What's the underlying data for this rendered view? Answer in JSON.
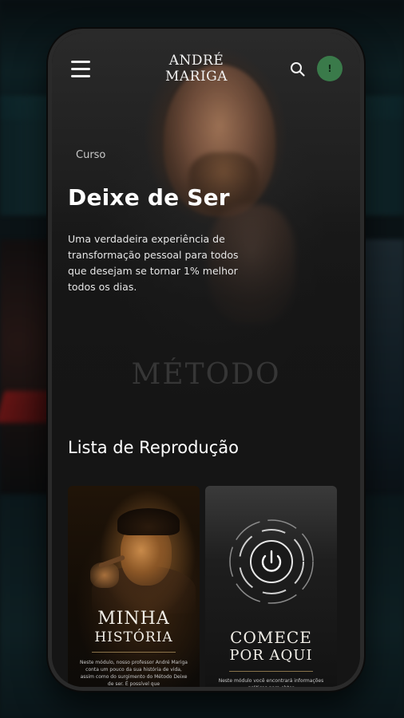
{
  "app": {
    "logo_line1": "ANDRÉ",
    "logo_line2": "MARIGA",
    "avatar_initial": "!"
  },
  "hero": {
    "tag": "Curso",
    "title": "Deixe de Ser",
    "description": "Uma verdadeira experiência de transformação pessoal para todos que desejam se tornar 1% melhor todos os dias.",
    "brand_word": "MÉTODO"
  },
  "playlist": {
    "title": "Lista de Reprodução",
    "cards": [
      {
        "title_line1": "MINHA",
        "title_line2": "HISTÓRIA",
        "description": "Neste módulo, nosso professor André Mariga conta um pouco da sua história de vida, assim como do surgimento do Método Deixe de ser. É possível que"
      },
      {
        "title_line1": "COMECE",
        "title_line2": "POR AQUI",
        "description": "Neste módulo você encontrará informações práticas para obter"
      }
    ]
  },
  "colors": {
    "accent_avatar": "#3a7a4a",
    "background": "#151515"
  },
  "icons": [
    "menu-icon",
    "search-icon",
    "power-icon"
  ]
}
